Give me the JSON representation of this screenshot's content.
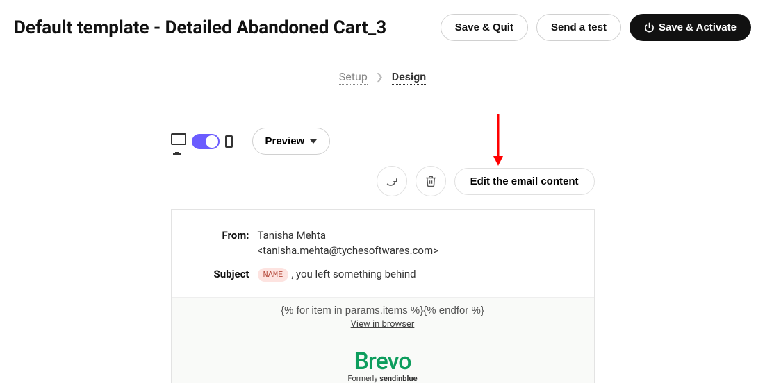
{
  "header": {
    "title": "Default template - Detailed Abandoned Cart_3",
    "save_quit_label": "Save & Quit",
    "send_test_label": "Send a test",
    "save_activate_label": "Save & Activate"
  },
  "breadcrumb": {
    "step1": "Setup",
    "step2": "Design"
  },
  "toolbar": {
    "preview_label": "Preview"
  },
  "actions": {
    "edit_label": "Edit the email content"
  },
  "email": {
    "from_label": "From:",
    "from_name": "Tanisha Mehta",
    "from_email": "<tanisha.mehta@tychesoftwares.com>",
    "subject_label": "Subject",
    "subject_badge": "NAME",
    "subject_text": ", you left something behind",
    "template_loop": "{% for item in params.items %}{% endfor %}",
    "view_browser": "View in browser",
    "logo_text": "Brevo",
    "logo_sub_prefix": "Formerly ",
    "logo_sub_bold": "sendinblue"
  }
}
